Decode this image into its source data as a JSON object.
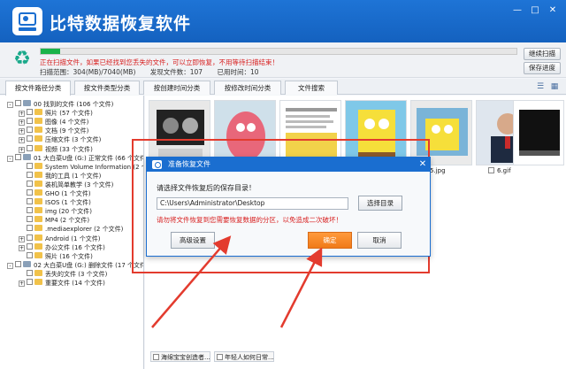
{
  "app": {
    "title": "比特数据恢复软件"
  },
  "status": {
    "progress_percent": 4,
    "message": "正在扫描文件，如果已经找到您丢失的文件，可以立即恢复，不用等待扫描结束！",
    "scan_range": "扫描范围：304(MB)/7040(MB)",
    "found_files": "发现文件数：107",
    "elapsed": "已用时间：10",
    "continue_label": "继续扫描",
    "save_progress_label": "保存进度"
  },
  "tabs": [
    "按文件路径分类",
    "按文件类型分类",
    "按创建时间分类",
    "按修改时间分类",
    "文件搜索"
  ],
  "tree": [
    {
      "text": "00 找到的文件   (106 个文件)",
      "level": 0,
      "expander": "-",
      "icon": "drive"
    },
    {
      "text": "照片    (57 个文件)",
      "level": 1,
      "expander": "+",
      "icon": "folder"
    },
    {
      "text": "图像    (4 个文件)",
      "level": 1,
      "expander": "+",
      "icon": "folder"
    },
    {
      "text": "文档    (9 个文件)",
      "level": 1,
      "expander": "+",
      "icon": "folder"
    },
    {
      "text": "压缩文件   (3 个文件)",
      "level": 1,
      "expander": "+",
      "icon": "folder"
    },
    {
      "text": "视频    (33 个文件)",
      "level": 1,
      "expander": "+",
      "icon": "folder"
    },
    {
      "text": "01 大白菜U盘 (G:) 正常文件 (66 个文件)",
      "level": 0,
      "expander": "-",
      "icon": "drive"
    },
    {
      "text": "System Volume Information   (2 个文件)",
      "level": 1,
      "expander": "",
      "icon": "folder"
    },
    {
      "text": "我的工具   (1 个文件)",
      "level": 1,
      "expander": "",
      "icon": "folder"
    },
    {
      "text": "装机简单教学   (3 个文件)",
      "level": 1,
      "expander": "",
      "icon": "folder"
    },
    {
      "text": "GHO   (1 个文件)",
      "level": 1,
      "expander": "",
      "icon": "folder"
    },
    {
      "text": "ISOS   (1 个文件)",
      "level": 1,
      "expander": "",
      "icon": "folder"
    },
    {
      "text": "img   (20 个文件)",
      "level": 1,
      "expander": "",
      "icon": "folder"
    },
    {
      "text": "MP4   (2 个文件)",
      "level": 1,
      "expander": "",
      "icon": "folder"
    },
    {
      "text": ".mediaexplorer   (2 个文件)",
      "level": 1,
      "expander": "",
      "icon": "folder"
    },
    {
      "text": "Android   (1 个文件)",
      "level": 1,
      "expander": "+",
      "icon": "folder"
    },
    {
      "text": "办公文件   (16 个文件)",
      "level": 1,
      "expander": "+",
      "icon": "folder"
    },
    {
      "text": "照片   (16 个文件)",
      "level": 1,
      "expander": "",
      "icon": "folder"
    },
    {
      "text": "02 大白菜U盘 (G:) 删除文件 (17 个文件)",
      "level": 0,
      "expander": "-",
      "icon": "drive"
    },
    {
      "text": "丢失的文件   (3 个文件)",
      "level": 1,
      "expander": "",
      "icon": "folder"
    },
    {
      "text": "重要文件   (14 个文件)",
      "level": 1,
      "expander": "+",
      "icon": "folder"
    }
  ],
  "thumbnails": {
    "labels": [
      "5.jpg",
      "6.gif"
    ],
    "bottom_labels": [
      "海绵宝宝创造者...",
      "年轻人如何日常..."
    ]
  },
  "dialog": {
    "title": "准备恢复文件",
    "prompt": "请选择文件恢复后的保存目录！",
    "path_value": "C:\\Users\\Administrator\\Desktop",
    "choose_dir_label": "选择目录",
    "warning": "请勿将文件恢复到您需要恢复数据的分区，以免造成二次破坏！",
    "advanced_label": "高级设置",
    "ok_label": "确定",
    "cancel_label": "取消"
  },
  "colors": {
    "accent": "#1a6ed0",
    "highlight": "#e33b2e",
    "warning": "#d82020",
    "ok": "#f07a18",
    "progress": "#1ab34a"
  }
}
